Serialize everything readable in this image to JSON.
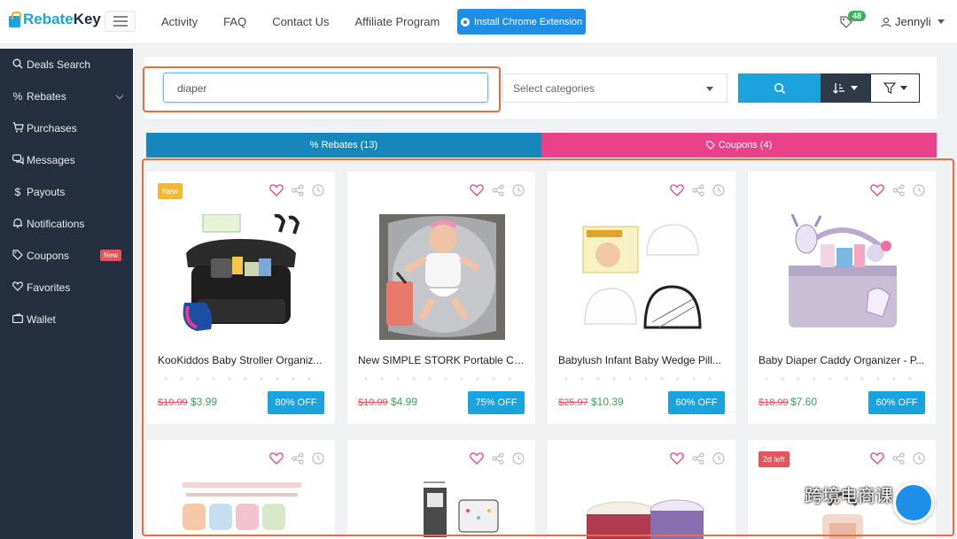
{
  "brand": {
    "name_prefix": "Rebate",
    "name_suffix": "Key"
  },
  "nav": {
    "links": [
      "Activity",
      "FAQ",
      "Contact Us",
      "Affiliate Program"
    ],
    "install_button": "Install Chrome Extension",
    "notification_count": "48",
    "username": "Jennyli"
  },
  "sidebar": {
    "items": [
      {
        "icon": "search-icon",
        "label": "Deals Search"
      },
      {
        "icon": "percent-icon",
        "label": "Rebates"
      },
      {
        "icon": "cart-icon",
        "label": "Purchases"
      },
      {
        "icon": "chat-icon",
        "label": "Messages"
      },
      {
        "icon": "dollar-icon",
        "label": "Payouts"
      },
      {
        "icon": "bell-icon",
        "label": "Notifications"
      },
      {
        "icon": "tag-icon",
        "label": "Coupons",
        "badge": "New"
      },
      {
        "icon": "heart-icon",
        "label": "Favorites"
      },
      {
        "icon": "wallet-icon",
        "label": "Wallet"
      }
    ]
  },
  "search": {
    "query": "diaper",
    "category_placeholder": "Select categories"
  },
  "tabs": {
    "rebates": "% Rebates (13)",
    "coupons": "Coupons (4)"
  },
  "colors": {
    "accent_blue": "#1ba3dd",
    "rebates_tab": "#1787bb",
    "coupons_tab": "#e9428b",
    "sidebar_bg": "#243040",
    "highlight_orange": "#ef6b3b",
    "tag_new": "#f5b731",
    "tag_left": "#e5545a"
  },
  "products": [
    {
      "tag": "New",
      "title": "KooKiddos Baby Stroller Organiz...",
      "old_price": "$19.99",
      "price": "$3.99",
      "discount": "80% OFF"
    },
    {
      "title": "New SIMPLE STORK Portable Ch...",
      "old_price": "$19.99",
      "price": "$4.99",
      "discount": "75% OFF"
    },
    {
      "title": "Babylush Infant Baby Wedge Pill...",
      "old_price": "$25.97",
      "price": "$10.39",
      "discount": "60% OFF"
    },
    {
      "title": "Baby Diaper Caddy Organizer - P...",
      "old_price": "$18.99",
      "price": "$7.60",
      "discount": "60% OFF"
    },
    {},
    {},
    {},
    {
      "tag": "2d left"
    }
  ],
  "watermark": "跨境电商课"
}
